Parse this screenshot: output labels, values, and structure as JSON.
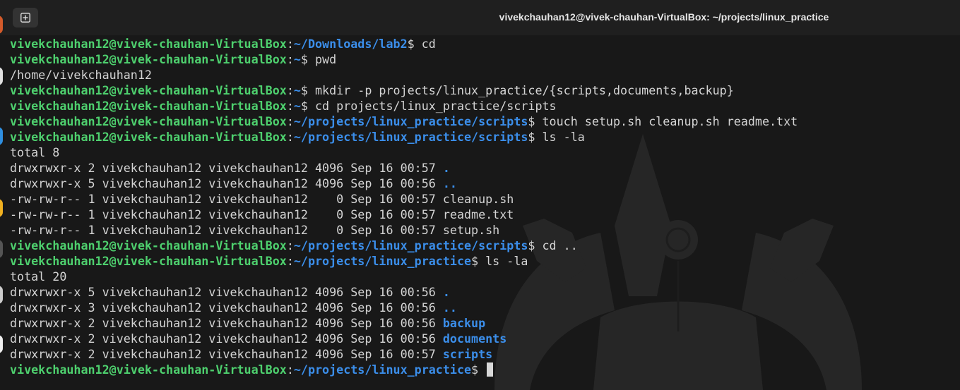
{
  "window": {
    "title": "vivekchauhan12@vivek-chauhan-VirtualBox: ~/projects/linux_practice"
  },
  "colors": {
    "prompt_user": "#4ed06e",
    "prompt_path": "#3b8eea",
    "text": "#d4d4d4",
    "background": "#181818"
  },
  "prompt": {
    "user_host": "vivekchauhan12@vivek-chauhan-VirtualBox",
    "sep": ":"
  },
  "terminal": {
    "lines": [
      {
        "path": "~/Downloads/lab2",
        "cmd": "$ cd"
      },
      {
        "path": "~",
        "cmd": "$ pwd"
      },
      {
        "out": "/home/vivekchauhan12"
      },
      {
        "path": "~",
        "cmd": "$ mkdir -p projects/linux_practice/{scripts,documents,backup}"
      },
      {
        "path": "~",
        "cmd": "$ cd projects/linux_practice/scripts"
      },
      {
        "path": "~/projects/linux_practice/scripts",
        "cmd": "$ touch setup.sh cleanup.sh readme.txt"
      },
      {
        "path": "~/projects/linux_practice/scripts",
        "cmd": "$ ls -la"
      },
      {
        "out": "total 8"
      },
      {
        "out": "drwxrwxr-x 2 vivekchauhan12 vivekchauhan12 4096 Sep 16 00:57 ",
        "name": "."
      },
      {
        "out": "drwxrwxr-x 5 vivekchauhan12 vivekchauhan12 4096 Sep 16 00:56 ",
        "name": ".."
      },
      {
        "out": "-rw-rw-r-- 1 vivekchauhan12 vivekchauhan12    0 Sep 16 00:57 cleanup.sh"
      },
      {
        "out": "-rw-rw-r-- 1 vivekchauhan12 vivekchauhan12    0 Sep 16 00:57 readme.txt"
      },
      {
        "out": "-rw-rw-r-- 1 vivekchauhan12 vivekchauhan12    0 Sep 16 00:57 setup.sh"
      },
      {
        "path": "~/projects/linux_practice/scripts",
        "cmd": "$ cd .."
      },
      {
        "path": "~/projects/linux_practice",
        "cmd": "$ ls -la"
      },
      {
        "out": "total 20"
      },
      {
        "out": "drwxrwxr-x 5 vivekchauhan12 vivekchauhan12 4096 Sep 16 00:56 ",
        "name": "."
      },
      {
        "out": "drwxrwxr-x 3 vivekchauhan12 vivekchauhan12 4096 Sep 16 00:56 ",
        "name": ".."
      },
      {
        "out": "drwxrwxr-x 2 vivekchauhan12 vivekchauhan12 4096 Sep 16 00:56 ",
        "name": "backup"
      },
      {
        "out": "drwxrwxr-x 2 vivekchauhan12 vivekchauhan12 4096 Sep 16 00:56 ",
        "name": "documents"
      },
      {
        "out": "drwxrwxr-x 2 vivekchauhan12 vivekchauhan12 4096 Sep 16 00:57 ",
        "name": "scripts"
      },
      {
        "path": "~/projects/linux_practice",
        "cmd": "$ ",
        "cursor": true
      }
    ]
  },
  "icons": {
    "new_tab": "new-tab-icon",
    "watermark": "ubuntu-crown-watermark"
  }
}
